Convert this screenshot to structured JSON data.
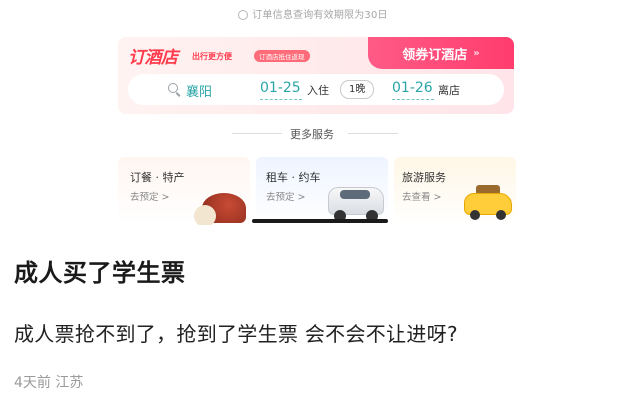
{
  "notice": {
    "text": "订单信息查询有效期限为30日"
  },
  "hotel": {
    "brand": "订酒店",
    "slogan": "出行更方便",
    "chip": "订酒店抵住返现",
    "coupon_button": "领券订酒店",
    "coupon_chevron": "»",
    "search": {
      "city": "襄阳",
      "checkin_date": "01-25",
      "checkin_label": "入住",
      "nights": "1晚",
      "checkout_date": "01-26",
      "checkout_label": "离店"
    }
  },
  "services": {
    "title": "更多服务",
    "items": [
      {
        "title": "订餐 · 特产",
        "sub": "去预定 >"
      },
      {
        "title": "租车 · 约车",
        "sub": "去预定 >"
      },
      {
        "title": "旅游服务",
        "sub": "去查看 >"
      }
    ]
  },
  "post": {
    "title": "成人买了学生票",
    "body": "成人票抢不到了，抢到了学生票 会不会不让进呀?",
    "meta": "4天前 江苏"
  }
}
